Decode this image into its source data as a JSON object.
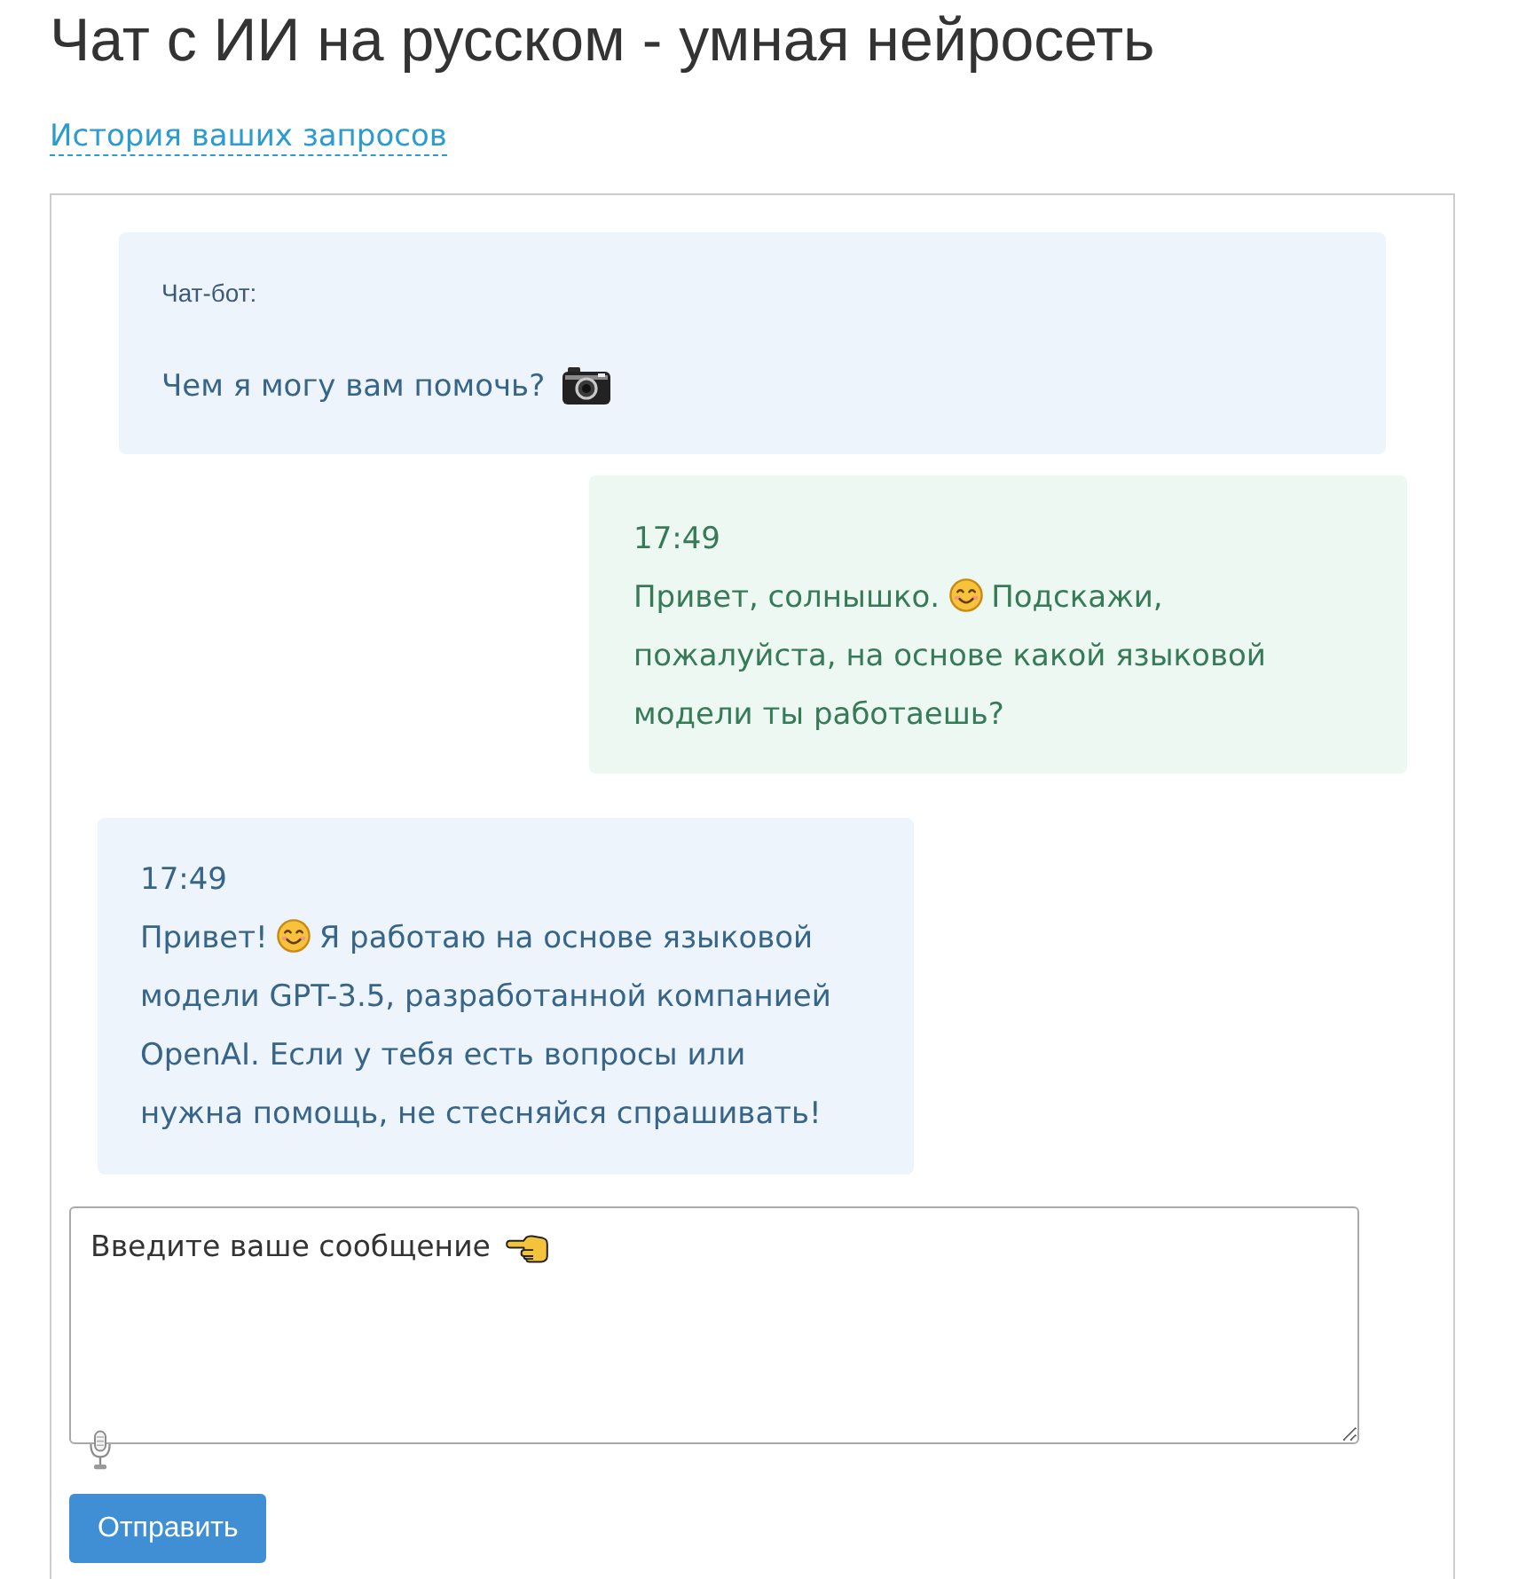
{
  "page": {
    "title": "Чат с ИИ на русском - умная нейросеть",
    "history_link": "История ваших запросов"
  },
  "chat": {
    "messages": [
      {
        "kind": "greeting",
        "author": "Чат-бот:",
        "text_before": "Чем я могу вам помочь?"
      },
      {
        "kind": "outgoing",
        "time": "17:49",
        "text_before": "Привет, солнышко.",
        "text_after": "Подскажи, пожалуйста, на основе какой языковой модели ты работаешь?"
      },
      {
        "kind": "incoming",
        "time": "17:49",
        "text_before": "Привет!",
        "text_after": "Я работаю на основе языковой модели GPT-3.5, разработанной компанией OpenAI. Если у тебя есть вопросы или нужна помощь, не стесняйся спрашивать!"
      }
    ]
  },
  "composer": {
    "placeholder": "Введите ваше сообщение",
    "send_button": "Отправить"
  }
}
